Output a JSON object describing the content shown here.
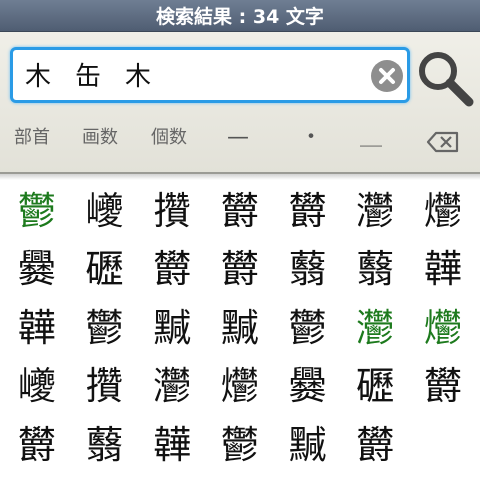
{
  "title": "検索結果 : 34 文字",
  "search": {
    "query": "木缶木"
  },
  "tools": {
    "bushu": "部首",
    "kakusu": "画数",
    "kosu": "個数",
    "dash": "—",
    "dot": "・",
    "underline": "＿"
  },
  "colors": {
    "accent": "#2a9be6",
    "highlight": "#1d7a1d"
  },
  "results": [
    {
      "char": "鬱",
      "green": true
    },
    {
      "char": "巙",
      "green": false
    },
    {
      "char": "攢",
      "green": false
    },
    {
      "char": "欝",
      "green": false
    },
    {
      "char": "欝",
      "green": false
    },
    {
      "char": "灪",
      "green": false
    },
    {
      "char": "爩",
      "green": false
    },
    {
      "char": "爨",
      "green": false
    },
    {
      "char": "礰",
      "green": false
    },
    {
      "char": "欝",
      "green": false
    },
    {
      "char": "欝",
      "green": false
    },
    {
      "char": "蘙",
      "green": false
    },
    {
      "char": "蘙",
      "green": false
    },
    {
      "char": "韡",
      "green": false
    },
    {
      "char": "韡",
      "green": false
    },
    {
      "char": "鬱",
      "green": false
    },
    {
      "char": "黬",
      "green": false
    },
    {
      "char": "黬",
      "green": false
    },
    {
      "char": "鬱",
      "green": false
    },
    {
      "char": "灪",
      "green": true
    },
    {
      "char": "爩",
      "green": true
    },
    {
      "char": "巙",
      "green": false
    },
    {
      "char": "攢",
      "green": false
    },
    {
      "char": "灪",
      "green": false
    },
    {
      "char": "爩",
      "green": false
    },
    {
      "char": "爨",
      "green": false
    },
    {
      "char": "礰",
      "green": false
    },
    {
      "char": "欝",
      "green": false
    },
    {
      "char": "欝",
      "green": false
    },
    {
      "char": "蘙",
      "green": false
    },
    {
      "char": "韡",
      "green": false
    },
    {
      "char": "鬱",
      "green": false
    },
    {
      "char": "黬",
      "green": false
    },
    {
      "char": "欝",
      "green": false
    }
  ]
}
